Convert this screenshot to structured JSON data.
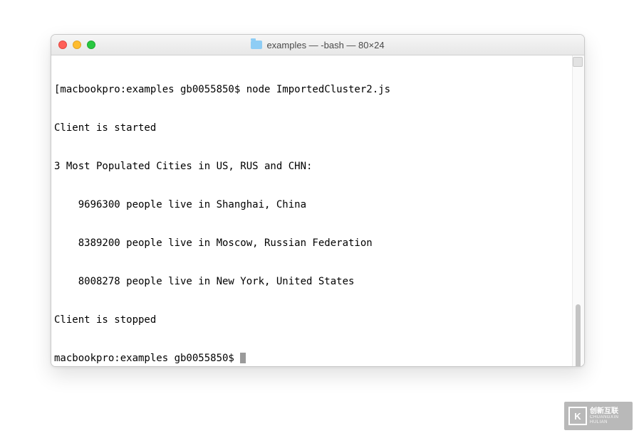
{
  "window": {
    "title": "examples — -bash — 80×24",
    "folder_icon": "folder-icon"
  },
  "traffic": {
    "close": "close-icon",
    "minimize": "minimize-icon",
    "maximize": "maximize-icon"
  },
  "terminal": {
    "lines": [
      "[macbookpro:examples gb0055850$ node ImportedCluster2.js",
      "Client is started",
      "3 Most Populated Cities in US, RUS and CHN:",
      "    9696300 people live in Shanghai, China",
      "    8389200 people live in Moscow, Russian Federation",
      "    8008278 people live in New York, United States",
      "Client is stopped"
    ],
    "prompt": "macbookpro:examples gb0055850$ "
  },
  "watermark": {
    "brand": "创新互联",
    "sub": "CHUANGXIN HULIAN",
    "logo_letter": "K"
  }
}
